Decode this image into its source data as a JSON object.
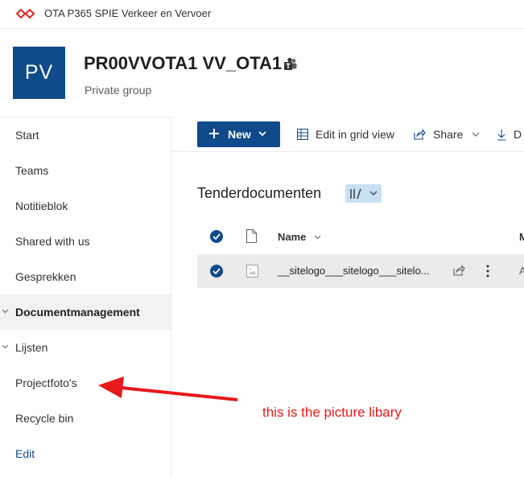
{
  "topbar": {
    "title": "OTA P365 SPIE Verkeer en Vervoer"
  },
  "site": {
    "logo_text": "PV",
    "title": "PR00VVOTA1 VV_OTA1",
    "subtitle": "Private group"
  },
  "nav": {
    "items": [
      {
        "label": "Start"
      },
      {
        "label": "Teams"
      },
      {
        "label": "Notitieblok"
      },
      {
        "label": "Shared with us"
      },
      {
        "label": "Gesprekken"
      },
      {
        "label": "Documentmanagement"
      },
      {
        "label": "Lijsten"
      },
      {
        "label": "Projectfoto's"
      },
      {
        "label": "Recycle bin"
      },
      {
        "label": "Edit"
      }
    ]
  },
  "commandbar": {
    "new_label": "New",
    "edit_grid_label": "Edit in grid view",
    "share_label": "Share",
    "download_label": "D"
  },
  "library": {
    "title": "Tenderdocumenten",
    "columns": {
      "name": "Name",
      "modified": "M"
    },
    "rows": [
      {
        "name": "__sitelogo___sitelogo___sitelo...",
        "modified": "A"
      }
    ]
  },
  "annotation": {
    "text": "this is the picture libary"
  },
  "colors": {
    "accent": "#0f4a8a",
    "annotation": "#e8191b",
    "selected_row": "#edebe9"
  }
}
